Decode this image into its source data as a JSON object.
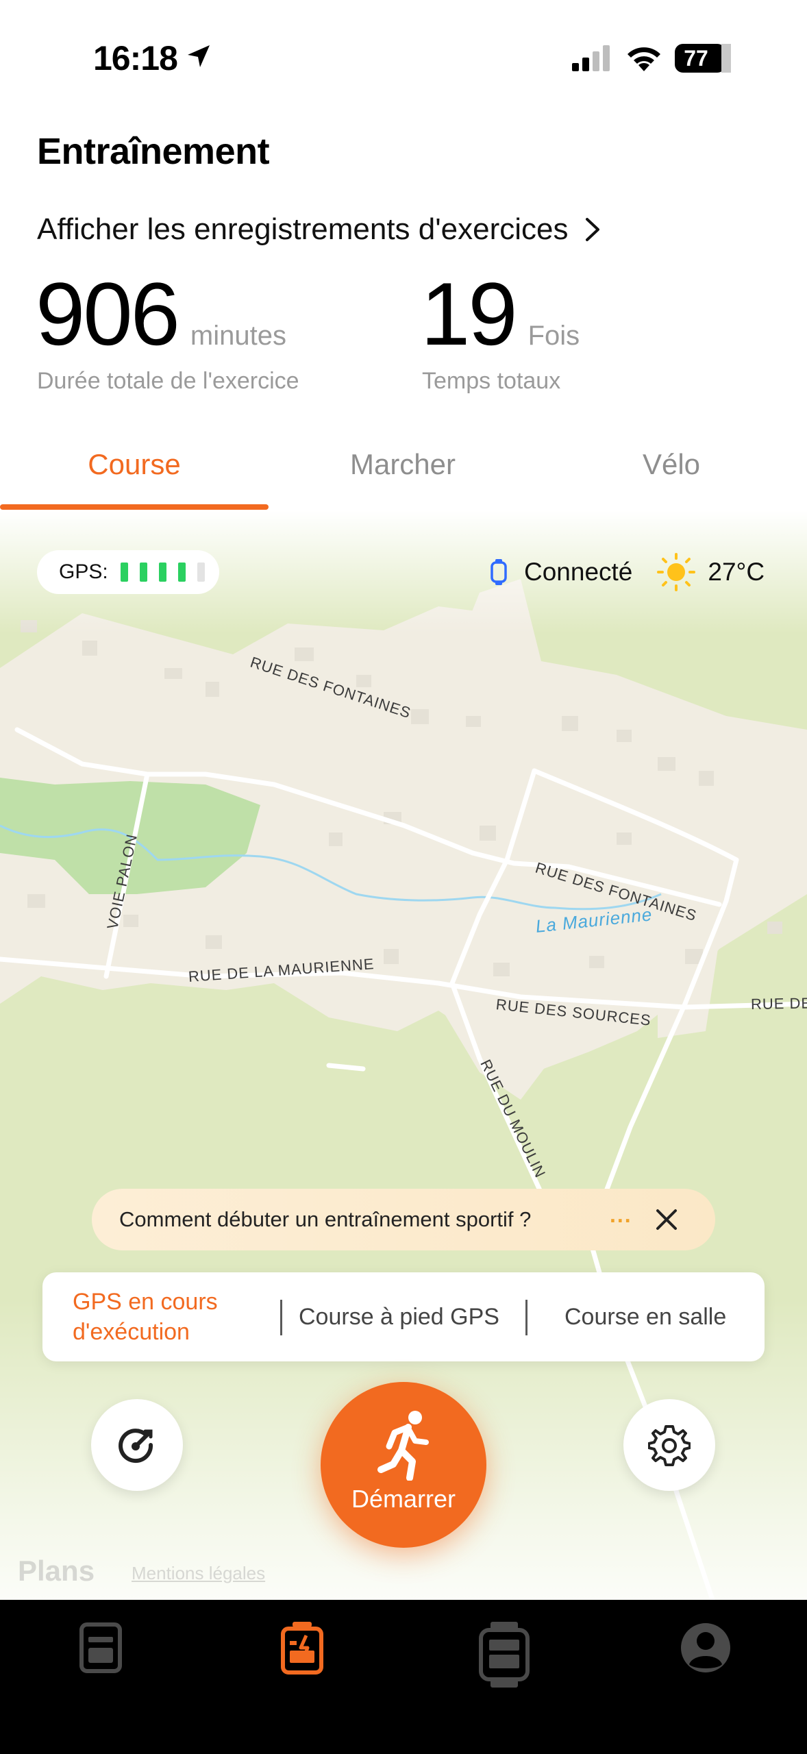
{
  "status_bar": {
    "time": "16:18",
    "battery": "77"
  },
  "page": {
    "title": "Entraînement",
    "records_link": "Afficher les enregistrements d'exercices"
  },
  "stats": {
    "duration": {
      "value": "906",
      "unit": "minutes",
      "label": "Durée totale de l'exercice"
    },
    "count": {
      "value": "19",
      "unit": "Fois",
      "label": "Temps totaux"
    }
  },
  "tabs": [
    {
      "label": "Course",
      "active": true
    },
    {
      "label": "Marcher",
      "active": false
    },
    {
      "label": "Vélo",
      "active": false
    }
  ],
  "map": {
    "gps_label": "GPS:",
    "gps_signal_bars": 4,
    "gps_signal_max": 5,
    "device_status": "Connecté",
    "temperature": "27°C",
    "streets": {
      "fontaines_1": "RUE DES FONTAINES",
      "fontaines_2": "RUE DES FONTAINES",
      "voie_palon": "VOIE PALON",
      "maurienne": "RUE DE LA MAURIENNE",
      "sources": "RUE DES SOURCES",
      "moulin": "RUE DU MOULIN",
      "edge": "RUE DE"
    },
    "river": "La Maurienne",
    "attribution": "Plans",
    "legal": "Mentions légales"
  },
  "tip": {
    "text": "Comment débuter un entraînement sportif ?",
    "dots": "..."
  },
  "modes": [
    {
      "label": "GPS en cours d'exécution",
      "active": true
    },
    {
      "label": "Course à pied GPS",
      "active": false
    },
    {
      "label": "Course en salle",
      "active": false
    }
  ],
  "start_button": {
    "label": "Démarrer"
  },
  "colors": {
    "accent": "#f26a20",
    "gps_green": "#2bd060",
    "nav_bg": "#000000"
  },
  "bottom_nav": [
    {
      "icon": "home-icon",
      "active": false
    },
    {
      "icon": "workout-icon",
      "active": true
    },
    {
      "icon": "device-icon",
      "active": false
    },
    {
      "icon": "profile-icon",
      "active": false
    }
  ]
}
